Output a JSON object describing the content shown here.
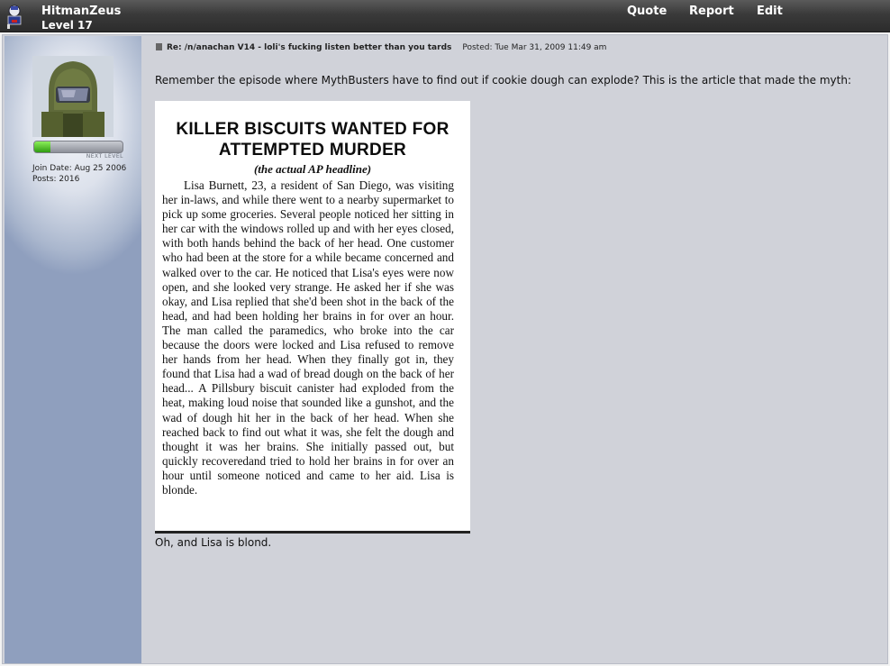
{
  "user": {
    "name": "HitmanZeus",
    "level": "Level 17",
    "join_date": "Join Date: Aug 25 2006",
    "posts": "Posts: 2016",
    "xp_fraction": 0.18,
    "xp_caption": "NEXT LEVEL"
  },
  "actions": {
    "quote": "Quote",
    "report": "Report",
    "edit": "Edit"
  },
  "post": {
    "subject": "Re: /n/anachan V14 - loli's fucking listen better than you tards",
    "posted": "Posted: Tue Mar 31, 2009 11:49 am",
    "body_intro": "Remember the episode where MythBusters have to find out if cookie dough can explode? This is the article that made the myth:",
    "body_outro": "Oh, and Lisa is blond."
  },
  "clipping": {
    "headline_1": "KILLER BISCUITS WANTED FOR",
    "headline_2": "ATTEMPTED MURDER",
    "subheadline": "(the actual AP headline)",
    "text": "Lisa Burnett, 23, a resident of San Diego, was visiting her in-laws, and while there went to a nearby supermarket to pick up some groceries. Several people noticed her sitting in her car with the windows rolled up and with her eyes closed, with both hands behind the back of her head. One customer who had been at the store for a while became concerned and walked over to the car. He noticed that Lisa's eyes were now open, and she looked very strange. He asked her if she was okay, and Lisa replied that she'd been shot in the back of the head, and had been holding her brains in for over an hour. The man called the paramedics, who broke into the car because the doors were locked and Lisa refused to remove her hands from her head. When they finally got in, they found that Lisa had a wad of bread dough on the back of her head... A Pillsbury biscuit canister had exploded from the heat, making loud noise that sounded like a gunshot, and the wad of dough hit her in the back of her head. When she reached back to find out what it was, she felt the dough and thought it was her brains. She initially passed out, but quickly recoveredand tried to hold her brains in for over an hour until someone noticed and came to her aid. Lisa is blonde."
  },
  "icons": {
    "rank": "rank-badge-icon",
    "avatar": "helmet-avatar",
    "post": "document-icon"
  }
}
